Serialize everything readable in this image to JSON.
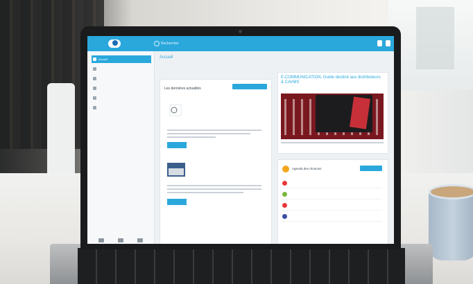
{
  "app": {
    "logo_text": "",
    "search_placeholder": "Rechercher",
    "page_title": "Accueil",
    "breadcrumb": ""
  },
  "sidebar": {
    "items": [
      {
        "label": "Accueil",
        "active": true
      },
      {
        "label": ""
      },
      {
        "label": ""
      },
      {
        "label": ""
      },
      {
        "label": ""
      },
      {
        "label": ""
      }
    ]
  },
  "news_card": {
    "title": "Les dernières actualités",
    "button": "",
    "items": [
      {
        "title": "",
        "more": ""
      },
      {
        "title": "",
        "more": ""
      }
    ]
  },
  "promo_card": {
    "title": "E-COMMUNICATION, Guide destiné aux distributeurs & CAVMS",
    "box_text": ""
  },
  "agenda_card": {
    "title": "Agenda des réunions",
    "button": "",
    "items": [
      {
        "label": "",
        "color": "#e8383d"
      },
      {
        "label": "",
        "color": "#7ab83a"
      },
      {
        "label": "",
        "color": "#e8383d"
      },
      {
        "label": "",
        "color": "#3950a3"
      }
    ]
  },
  "colors": {
    "accent": "#2aa8dc",
    "promo_red": "#7a1820",
    "agenda_icon": "#f3a61d"
  }
}
